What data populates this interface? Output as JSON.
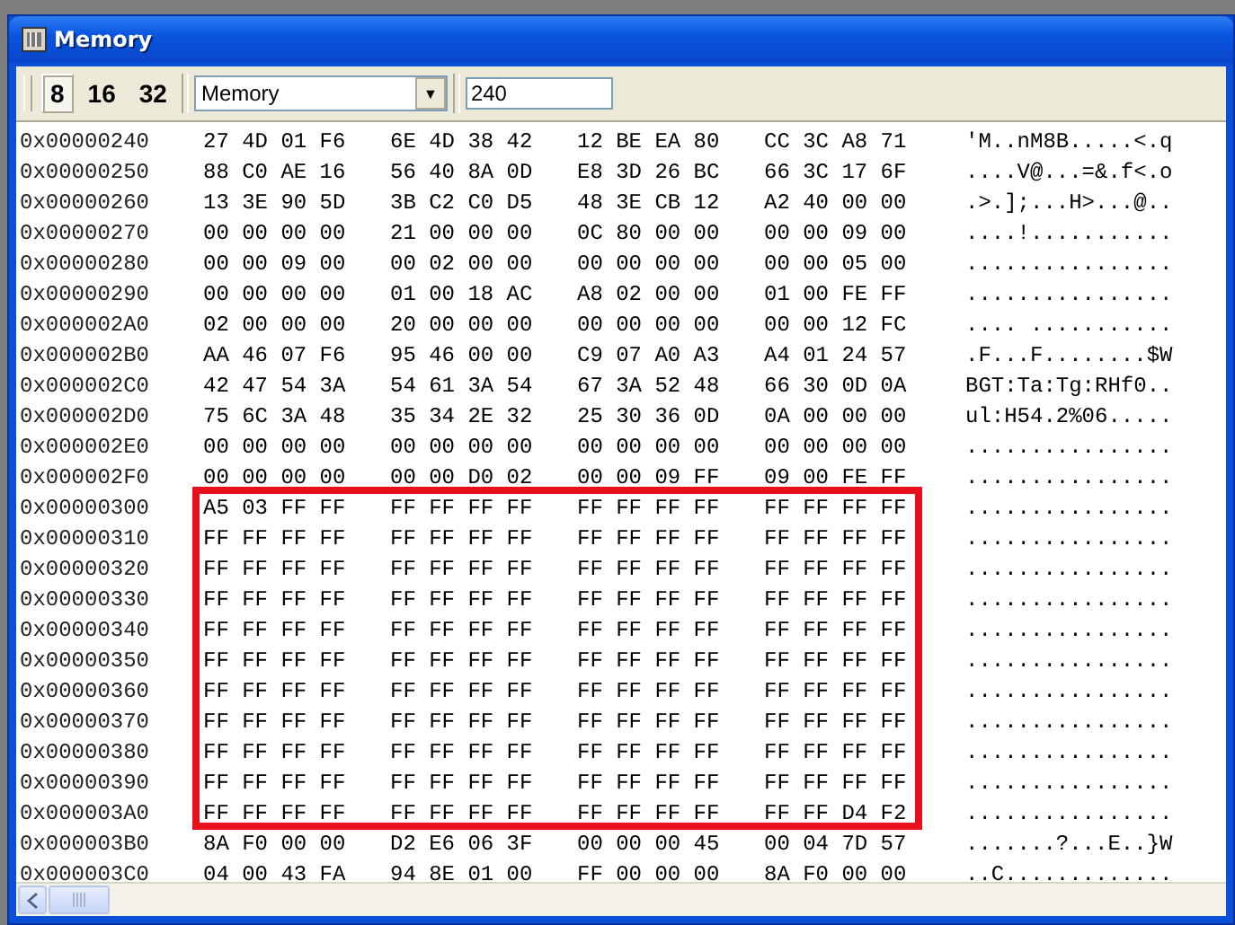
{
  "window": {
    "title": "Memory"
  },
  "toolbar": {
    "widths": [
      {
        "label": "8",
        "selected": true
      },
      {
        "label": "16",
        "selected": false
      },
      {
        "label": "32",
        "selected": false
      }
    ],
    "source": {
      "value": "Memory",
      "arrow": "▼"
    },
    "address": {
      "value": "240"
    }
  },
  "row_groups": [
    {
      "highlighted": false,
      "rows": [
        {
          "address": "0x00000240",
          "hex": [
            "27 4D 01 F6",
            "6E 4D 38 42",
            "12 BE EA 80",
            "CC 3C A8 71"
          ],
          "ascii": "'M..nM8B.....<.q"
        },
        {
          "address": "0x00000250",
          "hex": [
            "88 C0 AE 16",
            "56 40 8A 0D",
            "E8 3D 26 BC",
            "66 3C 17 6F"
          ],
          "ascii": "....V@...=&.f<.o"
        },
        {
          "address": "0x00000260",
          "hex": [
            "13 3E 90 5D",
            "3B C2 C0 D5",
            "48 3E CB 12",
            "A2 40 00 00"
          ],
          "ascii": ".>.];...H>...@.."
        },
        {
          "address": "0x00000270",
          "hex": [
            "00 00 00 00",
            "21 00 00 00",
            "0C 80 00 00",
            "00 00 09 00"
          ],
          "ascii": "....!..........."
        },
        {
          "address": "0x00000280",
          "hex": [
            "00 00 09 00",
            "00 02 00 00",
            "00 00 00 00",
            "00 00 05 00"
          ],
          "ascii": "................"
        },
        {
          "address": "0x00000290",
          "hex": [
            "00 00 00 00",
            "01 00 18 AC",
            "A8 02 00 00",
            "01 00 FE FF"
          ],
          "ascii": "................"
        },
        {
          "address": "0x000002A0",
          "hex": [
            "02 00 00 00",
            "20 00 00 00",
            "00 00 00 00",
            "00 00 12 FC"
          ],
          "ascii": ".... ..........."
        },
        {
          "address": "0x000002B0",
          "hex": [
            "AA 46 07 F6",
            "95 46 00 00",
            "C9 07 A0 A3",
            "A4 01 24 57"
          ],
          "ascii": ".F...F........$W"
        },
        {
          "address": "0x000002C0",
          "hex": [
            "42 47 54 3A",
            "54 61 3A 54",
            "67 3A 52 48",
            "66 30 0D 0A"
          ],
          "ascii": "BGT:Ta:Tg:RHf0.."
        },
        {
          "address": "0x000002D0",
          "hex": [
            "75 6C 3A 48",
            "35 34 2E 32",
            "25 30 36 0D",
            "0A 00 00 00"
          ],
          "ascii": "ul:H54.2%06....."
        },
        {
          "address": "0x000002E0",
          "hex": [
            "00 00 00 00",
            "00 00 00 00",
            "00 00 00 00",
            "00 00 00 00"
          ],
          "ascii": "................"
        },
        {
          "address": "0x000002F0",
          "hex": [
            "00 00 00 00",
            "00 00 D0 02",
            "00 00 09 FF",
            "09 00 FE FF"
          ],
          "ascii": "................"
        }
      ]
    },
    {
      "highlighted": true,
      "rows": [
        {
          "address": "0x00000300",
          "hex": [
            "A5 03 FF FF",
            "FF FF FF FF",
            "FF FF FF FF",
            "FF FF FF FF"
          ],
          "ascii": "................"
        },
        {
          "address": "0x00000310",
          "hex": [
            "FF FF FF FF",
            "FF FF FF FF",
            "FF FF FF FF",
            "FF FF FF FF"
          ],
          "ascii": "................"
        },
        {
          "address": "0x00000320",
          "hex": [
            "FF FF FF FF",
            "FF FF FF FF",
            "FF FF FF FF",
            "FF FF FF FF"
          ],
          "ascii": "................"
        },
        {
          "address": "0x00000330",
          "hex": [
            "FF FF FF FF",
            "FF FF FF FF",
            "FF FF FF FF",
            "FF FF FF FF"
          ],
          "ascii": "................"
        },
        {
          "address": "0x00000340",
          "hex": [
            "FF FF FF FF",
            "FF FF FF FF",
            "FF FF FF FF",
            "FF FF FF FF"
          ],
          "ascii": "................"
        },
        {
          "address": "0x00000350",
          "hex": [
            "FF FF FF FF",
            "FF FF FF FF",
            "FF FF FF FF",
            "FF FF FF FF"
          ],
          "ascii": "................"
        },
        {
          "address": "0x00000360",
          "hex": [
            "FF FF FF FF",
            "FF FF FF FF",
            "FF FF FF FF",
            "FF FF FF FF"
          ],
          "ascii": "................"
        },
        {
          "address": "0x00000370",
          "hex": [
            "FF FF FF FF",
            "FF FF FF FF",
            "FF FF FF FF",
            "FF FF FF FF"
          ],
          "ascii": "................"
        },
        {
          "address": "0x00000380",
          "hex": [
            "FF FF FF FF",
            "FF FF FF FF",
            "FF FF FF FF",
            "FF FF FF FF"
          ],
          "ascii": "................"
        },
        {
          "address": "0x00000390",
          "hex": [
            "FF FF FF FF",
            "FF FF FF FF",
            "FF FF FF FF",
            "FF FF FF FF"
          ],
          "ascii": "................"
        },
        {
          "address": "0x000003A0",
          "hex": [
            "FF FF FF FF",
            "FF FF FF FF",
            "FF FF FF FF",
            "FF FF D4 F2"
          ],
          "ascii": "................"
        }
      ]
    },
    {
      "highlighted": false,
      "rows": [
        {
          "address": "0x000003B0",
          "hex": [
            "8A F0 00 00",
            "D2 E6 06 3F",
            "00 00 00 45",
            "00 04 7D 57"
          ],
          "ascii": ".......?...E..}W"
        },
        {
          "address": "0x000003C0",
          "hex": [
            "04 00 43 FA",
            "94 8E 01 00",
            "FF 00 00 00",
            "8A F0 00 00"
          ],
          "ascii": "..C............."
        }
      ]
    }
  ]
}
